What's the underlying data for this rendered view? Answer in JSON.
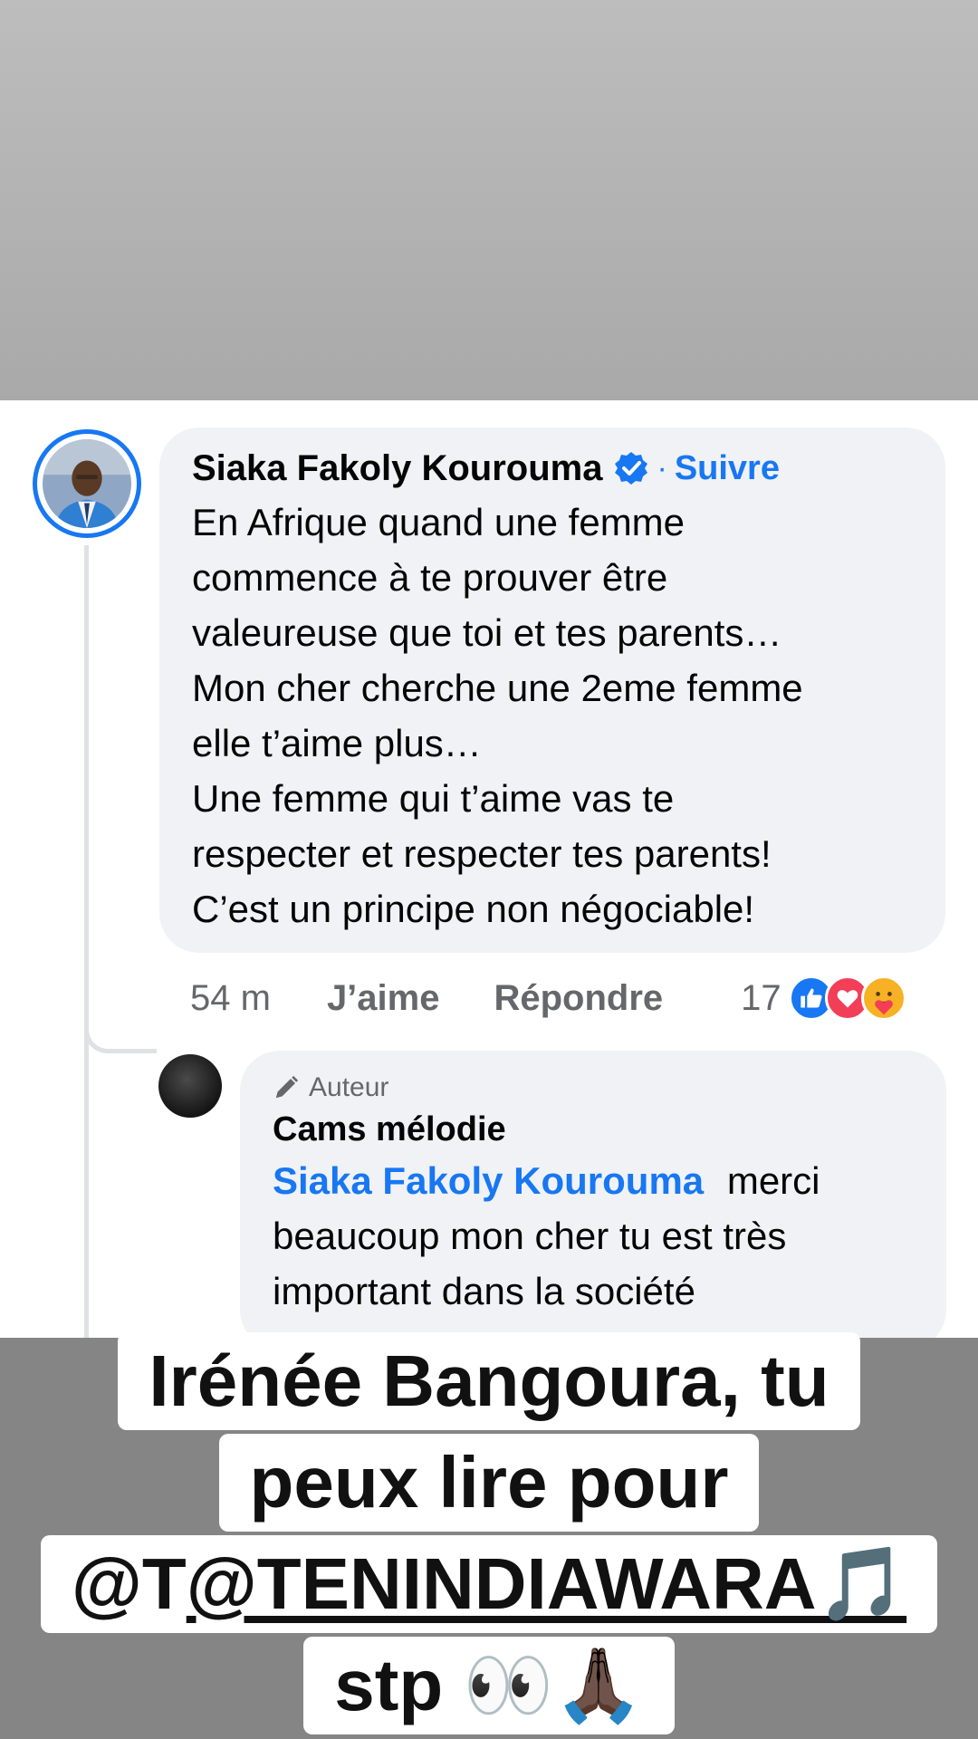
{
  "comment": {
    "author": "Siaka Fakoly Kourouma",
    "separator": "·",
    "follow_label": "Suivre",
    "lines": [
      "En Afrique quand une femme",
      "commence à te prouver être",
      "valeureuse que toi et tes parents…",
      "Mon cher cherche une 2eme femme",
      "elle t’aime plus…",
      "Une femme qui t’aime vas te",
      "respecter et respecter tes parents!",
      "C’est un principe non négociable!"
    ],
    "time": "54 m",
    "like_label": "J’aime",
    "reply_label": "Répondre",
    "reaction_count": "17",
    "reactions": [
      "like-icon",
      "love-icon",
      "care-icon"
    ]
  },
  "reply": {
    "badge_label": "Auteur",
    "author": "Cams mélodie",
    "mention": "Siaka Fakoly Kourouma",
    "text_line1": "merci",
    "text_line2": "beaucoup mon cher tu est très",
    "text_line3": "important dans la société"
  },
  "caption": {
    "line1": "Irénée Bangoura, tu",
    "line2": "peux lire pour",
    "line3_prefix": "@T",
    "line3_handle": "@TENINDIAWARA🎵",
    "line4": "stp 👀🙏🏿"
  },
  "colors": {
    "accent": "#1877f2",
    "bubble": "#f0f2f5",
    "muted_text": "#65676b",
    "love": "#f33e58",
    "care": "#f7b125"
  }
}
